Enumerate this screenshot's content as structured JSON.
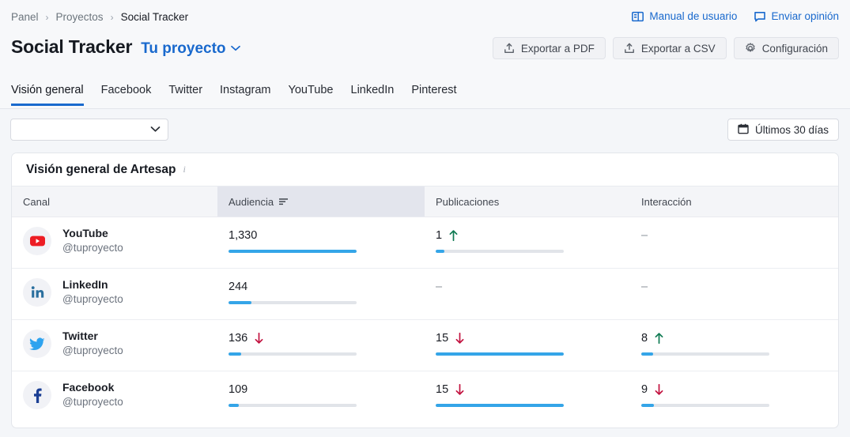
{
  "breadcrumb": {
    "items": [
      {
        "label": "Panel",
        "current": false
      },
      {
        "label": "Proyectos",
        "current": false
      },
      {
        "label": "Social Tracker",
        "current": true
      }
    ],
    "separator": "›"
  },
  "header": {
    "links": [
      {
        "label": "Manual de usuario",
        "icon": "book-icon"
      },
      {
        "label": "Enviar opinión",
        "icon": "feedback-icon"
      }
    ],
    "title": "Social Tracker",
    "project_name": "Tu proyecto",
    "project_chevron": "chevron-down-icon",
    "actions": [
      {
        "label": "Exportar a PDF",
        "icon": "export-icon"
      },
      {
        "label": "Exportar a CSV",
        "icon": "export-icon"
      },
      {
        "label": "Configuración",
        "icon": "gear-icon"
      }
    ]
  },
  "tabs": [
    {
      "label": "Visión general",
      "active": true
    },
    {
      "label": "Facebook",
      "active": false
    },
    {
      "label": "Twitter",
      "active": false
    },
    {
      "label": "Instagram",
      "active": false
    },
    {
      "label": "YouTube",
      "active": false
    },
    {
      "label": "LinkedIn",
      "active": false
    },
    {
      "label": "Pinterest",
      "active": false
    }
  ],
  "filters": {
    "select_value": "",
    "select_placeholder": "",
    "date_range_label": "Últimos 30 días",
    "date_icon": "calendar-icon"
  },
  "card": {
    "title": "Visión general de Artesap",
    "info_icon": "info-icon",
    "columns": [
      {
        "label": "Canal",
        "sorted": false
      },
      {
        "label": "Audiencia",
        "sorted": true,
        "sort_icon": "sort-icon"
      },
      {
        "label": "Publicaciones",
        "sorted": false
      },
      {
        "label": "Interacción",
        "sorted": false
      }
    ],
    "dash": "–"
  },
  "chart_data": {
    "type": "table",
    "title": "Visión general de Artesap",
    "columns": [
      "Canal",
      "Audiencia",
      "Publicaciones",
      "Interacción"
    ],
    "rows": [
      {
        "channel": "YouTube",
        "handle": "@tuproyecto",
        "icon": "youtube-icon",
        "audiencia": {
          "value": "1,330",
          "trend": "none",
          "bar_pct": 100
        },
        "publicaciones": {
          "value": "1",
          "trend": "up",
          "bar_pct": 7
        },
        "interaccion": {
          "value": "–",
          "trend": "none",
          "bar_pct": null
        }
      },
      {
        "channel": "LinkedIn",
        "handle": "@tuproyecto",
        "icon": "linkedin-icon",
        "audiencia": {
          "value": "244",
          "trend": "none",
          "bar_pct": 18
        },
        "publicaciones": {
          "value": "–",
          "trend": "none",
          "bar_pct": null
        },
        "interaccion": {
          "value": "–",
          "trend": "none",
          "bar_pct": null
        }
      },
      {
        "channel": "Twitter",
        "handle": "@tuproyecto",
        "icon": "twitter-icon",
        "audiencia": {
          "value": "136",
          "trend": "down",
          "bar_pct": 10
        },
        "publicaciones": {
          "value": "15",
          "trend": "down",
          "bar_pct": 100
        },
        "interaccion": {
          "value": "8",
          "trend": "up",
          "bar_pct": 9
        }
      },
      {
        "channel": "Facebook",
        "handle": "@tuproyecto",
        "icon": "facebook-icon",
        "audiencia": {
          "value": "109",
          "trend": "none",
          "bar_pct": 8
        },
        "publicaciones": {
          "value": "15",
          "trend": "down",
          "bar_pct": 100
        },
        "interaccion": {
          "value": "9",
          "trend": "down",
          "bar_pct": 10
        }
      }
    ]
  },
  "colors": {
    "accent": "#1969cd",
    "bar": "#34a5e8",
    "trend_up": "#0f7a52",
    "trend_down": "#c2123f",
    "youtube": "#ed1d24",
    "linkedin": "#2a6f9e",
    "twitter": "#2ea3ef",
    "facebook": "#1b3f94"
  }
}
